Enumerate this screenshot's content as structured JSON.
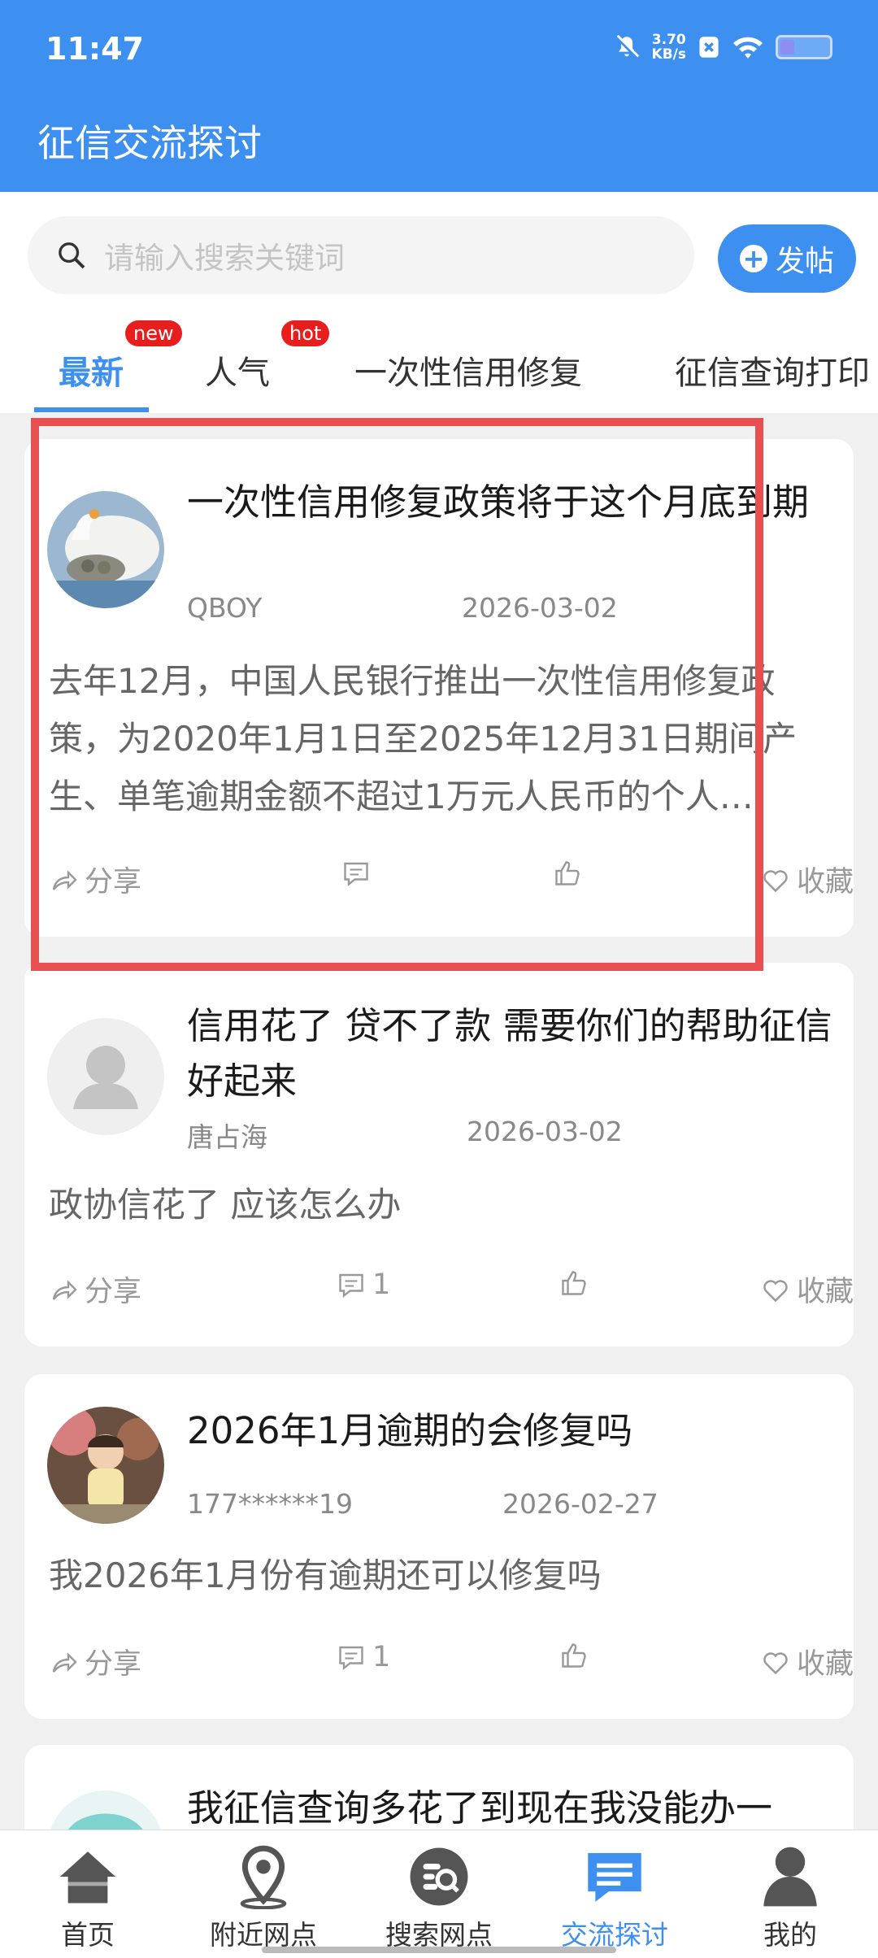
{
  "status_bar": {
    "time": "11:47",
    "speed_value": "3.70",
    "speed_unit": "KB/s",
    "battery_level": 0.3
  },
  "header": {
    "title": "征信交流探讨"
  },
  "search": {
    "placeholder": "请输入搜索关键词"
  },
  "post_button": {
    "label": "发帖"
  },
  "tabs": [
    {
      "label": "最新",
      "badge": "new",
      "active": true
    },
    {
      "label": "人气",
      "badge": "hot"
    },
    {
      "label": "一次性信用修复"
    },
    {
      "label": "征信查询打印"
    }
  ],
  "posts": [
    {
      "title": "一次性信用修复政策将于这个月底到期",
      "author": "QBOY",
      "date": "2026-03-02",
      "excerpt": "去年12月，中国人民银行推出一次性信用修复政策，为2020年1月1日至2025年12月31日期间产生、单笔逾期金额不超过1万元人民币的个人…",
      "share": "分享",
      "comments": "",
      "favorite": "收藏"
    },
    {
      "title": "信用花了 贷不了款 需要你们的帮助征信好起来",
      "author": "唐占海",
      "date": "2026-03-02",
      "excerpt": "政协信花了 应该怎么办",
      "share": "分享",
      "comments": "1",
      "favorite": "收藏"
    },
    {
      "title": "2026年1月逾期的会修复吗",
      "author": "177******19",
      "date": "2026-02-27",
      "excerpt": "我2026年1月份有逾期还可以修复吗",
      "share": "分享",
      "comments": "1",
      "favorite": "收藏"
    },
    {
      "title": "我征信查询多花了到现在我没能办一"
    }
  ],
  "bottom_nav": [
    {
      "label": "首页",
      "icon": "home-icon"
    },
    {
      "label": "附近网点",
      "icon": "location-pin-icon"
    },
    {
      "label": "搜索网点",
      "icon": "search-outlets-icon"
    },
    {
      "label": "交流探讨",
      "icon": "chat-icon",
      "active": true
    },
    {
      "label": "我的",
      "icon": "user-icon"
    }
  ],
  "colors": {
    "primary": "#3d8ff0",
    "badge": "#e81e1e",
    "highlight": "#e84f50"
  }
}
